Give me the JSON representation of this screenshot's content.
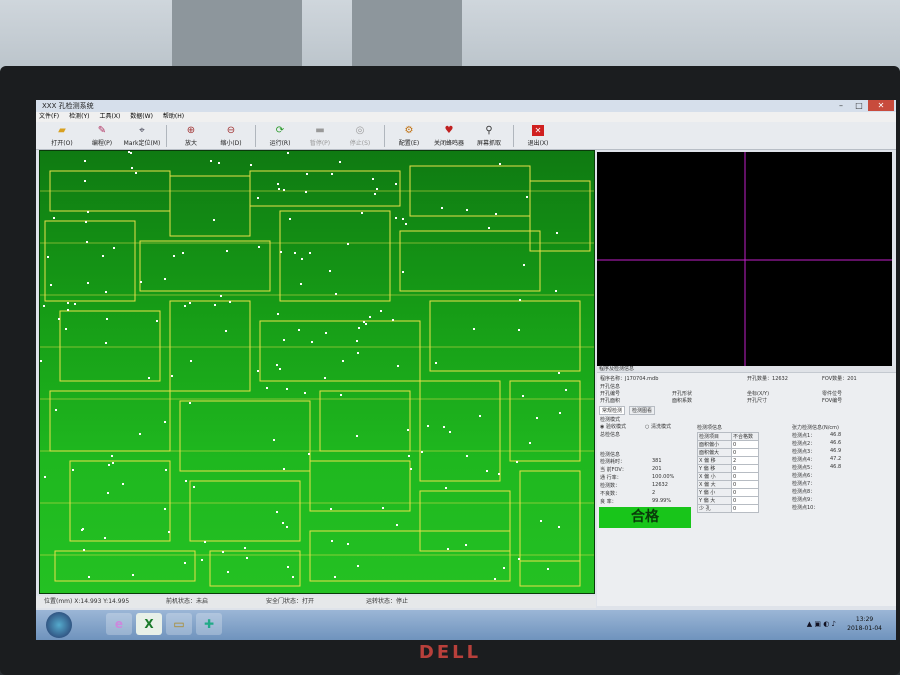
{
  "window": {
    "title": "XXX 孔检测系统"
  },
  "menu": [
    "文件(F)",
    "检测(Y)",
    "工具(X)",
    "数据(W)",
    "帮助(H)"
  ],
  "toolbar": [
    {
      "label": "打开(O)",
      "icon": "folder-icon",
      "enabled": true
    },
    {
      "label": "编程(P)",
      "icon": "edit-icon",
      "enabled": true
    },
    {
      "label": "Mark定位(M)",
      "icon": "target-icon",
      "enabled": true
    },
    {
      "label": "放大",
      "icon": "zoom-in-icon",
      "enabled": true
    },
    {
      "label": "缩小(D)",
      "icon": "zoom-out-icon",
      "enabled": true
    },
    {
      "label": "运行(R)",
      "icon": "run-icon",
      "enabled": true
    },
    {
      "label": "暂停(P)",
      "icon": "pause-icon",
      "enabled": false
    },
    {
      "label": "停止(S)",
      "icon": "stop-icon",
      "enabled": false
    },
    {
      "label": "配置(E)",
      "icon": "settings-icon",
      "enabled": true
    },
    {
      "label": "关闭蜂鸣器",
      "icon": "buzzer-icon",
      "enabled": true
    },
    {
      "label": "屏幕抓取",
      "icon": "capture-icon",
      "enabled": true
    },
    {
      "label": "退出(X)",
      "icon": "exit-icon",
      "enabled": true
    }
  ],
  "info": {
    "header": "程序及检测信息",
    "program_name_label": "程序名称：",
    "program_name": "J170704.mdb",
    "hole_count_label": "开孔数量：",
    "hole_count": "12632",
    "fov_count_label": "FOV数量：",
    "fov_count": "201",
    "hole_info_header": "开孔信息",
    "hole_no_label": "开孔编号",
    "hole_shape_label": "开孔形状",
    "coord_label": "坐标(X/Y)",
    "part_no_label": "零件位号",
    "hole_area_label": "开孔面积",
    "area_coef_label": "面积系数",
    "hole_size_label": "开孔尺寸",
    "fov_no_label": "FOV编号",
    "tabs": [
      "常规检测",
      "检测图看"
    ],
    "mode_header": "检测模式",
    "mode_options": [
      "验收模式",
      "清洗模式"
    ],
    "summary_header": "总检信息",
    "detect_info_header": "检测信息",
    "stats": [
      {
        "label": "检测耗时：",
        "value": "381"
      },
      {
        "label": "当 前FOV：",
        "value": "201"
      },
      {
        "label": "通 行率：",
        "value": "100.00%"
      },
      {
        "label": "检测数：",
        "value": "12632"
      },
      {
        "label": "不良数：",
        "value": "2"
      },
      {
        "label": "良    率：",
        "value": "99.99%"
      }
    ],
    "result": "合格",
    "items_header": "检测项信息",
    "items_col1": "检测项目",
    "items_col2": "不合格数",
    "items": [
      {
        "name": "面积偏小",
        "value": "0"
      },
      {
        "name": "面积偏大",
        "value": "0"
      },
      {
        "name": "X 偏 移",
        "value": "2"
      },
      {
        "name": "Y 偏 移",
        "value": "0"
      },
      {
        "name": "X 偏 小",
        "value": "0"
      },
      {
        "name": "X 偏 大",
        "value": "0"
      },
      {
        "name": "Y 偏 小",
        "value": "0"
      },
      {
        "name": "Y 偏 大",
        "value": "0"
      },
      {
        "name": "少 孔",
        "value": "0"
      }
    ],
    "tension_header": "张力检测信息(N/cm)",
    "tension": [
      {
        "label": "检测点1：",
        "value": "46.8"
      },
      {
        "label": "检测点2：",
        "value": "46.6"
      },
      {
        "label": "检测点3：",
        "value": "46.9"
      },
      {
        "label": "检测点4：",
        "value": "47.2"
      },
      {
        "label": "检测点5：",
        "value": "46.8"
      },
      {
        "label": "检测点6：",
        "value": ""
      },
      {
        "label": "检测点7：",
        "value": ""
      },
      {
        "label": "检测点8：",
        "value": ""
      },
      {
        "label": "检测点9：",
        "value": ""
      },
      {
        "label": "检测点10：",
        "value": ""
      }
    ]
  },
  "status": {
    "position": "位置(mm) X:14.993  Y:14.995",
    "run_state": "前机状态：未启",
    "safety_door": "安全门状态：打开",
    "motion_state": "运转状态：停止"
  },
  "taskbar": {
    "time": "13:29",
    "date": "2018-01-04"
  },
  "monitor_brand": "DELL",
  "colors": {
    "pcb_green": "#1fb81f",
    "outline_yellow": "#e8e04a",
    "crosshair": "#c020c8",
    "pass_green": "#18c51a"
  }
}
